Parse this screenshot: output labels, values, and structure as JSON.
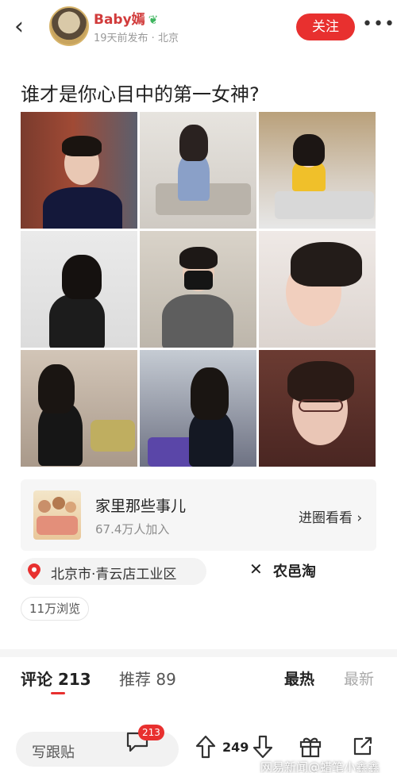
{
  "header": {
    "author_name": "Baby嫣",
    "author_badge_icon": "leaf-badge-icon",
    "meta": "19天前发布 · 北京",
    "follow_label": "关注",
    "more_label": "•••",
    "back_label": "‹"
  },
  "post": {
    "title": "谁才是你心目中的第一女神?",
    "photo_count": 9
  },
  "group": {
    "name": "家里那些事儿",
    "members": "67.4万人加入",
    "enter_label": "进圈看看 ›"
  },
  "location": {
    "text": "北京市·青云店工业区"
  },
  "brand": {
    "mark": "꘏",
    "name": "农邑淘"
  },
  "views": "11万浏览",
  "tabs": {
    "comments_label": "评论 213",
    "recommend_label": "推荐 89",
    "sort_hot": "最热",
    "sort_new": "最新"
  },
  "bottom_bar": {
    "reply_placeholder": "写跟贴",
    "comment_count": "213",
    "vote_count": "249",
    "watermark": "网易新闻@蜡笔小鑫鑫"
  },
  "colors": {
    "accent": "#e8302f",
    "author_name": "#d13b3b",
    "badge": "#3eb55f"
  }
}
